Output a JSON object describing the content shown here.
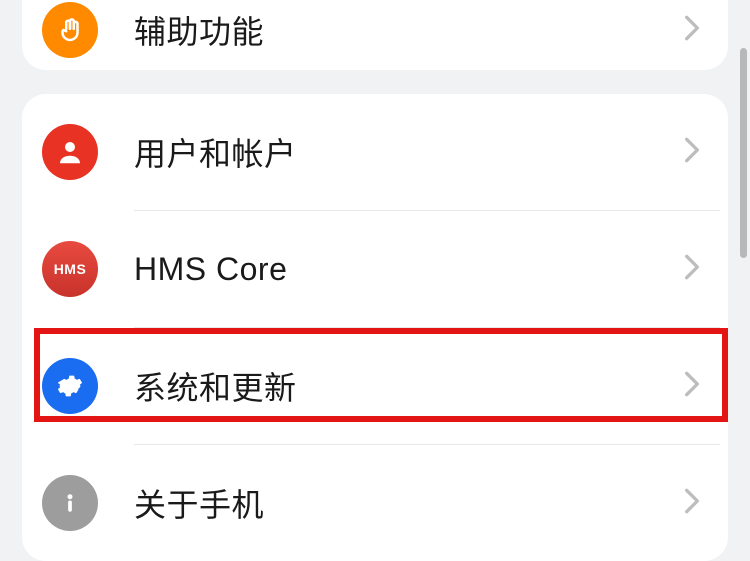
{
  "group_top": {
    "items": [
      {
        "label": "辅助功能"
      }
    ]
  },
  "group_bottom": {
    "items": [
      {
        "label": "用户和帐户"
      },
      {
        "label": "HMS Core"
      },
      {
        "label": "系统和更新"
      },
      {
        "label": "关于手机"
      }
    ]
  },
  "hms_badge_text": "HMS"
}
